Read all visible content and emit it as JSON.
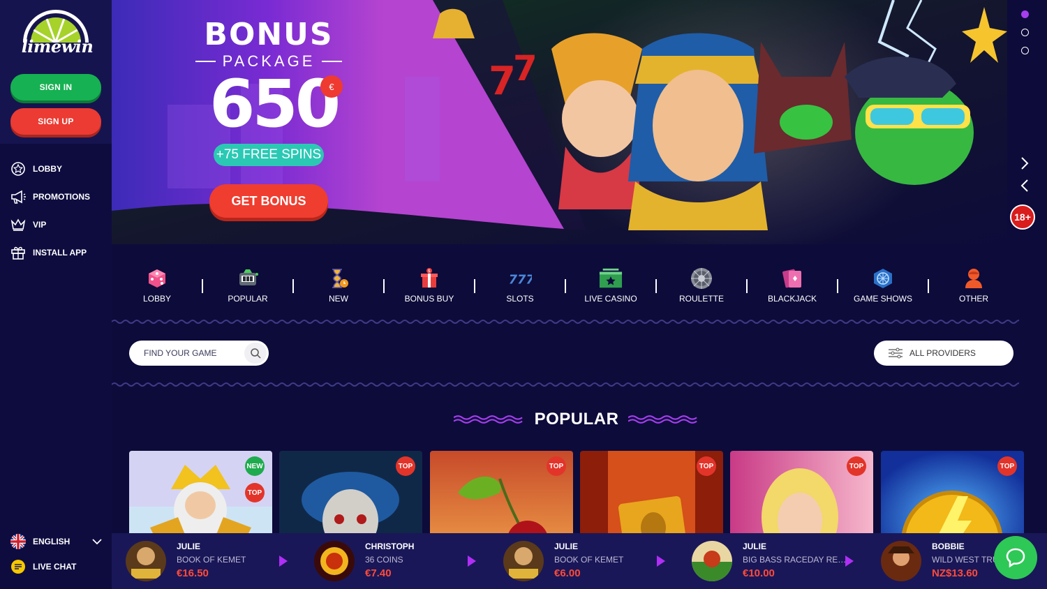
{
  "brand": {
    "logo_text": "limewin"
  },
  "auth": {
    "signin_label": "SIGN IN",
    "signup_label": "SIGN UP"
  },
  "sidebar": {
    "items": [
      {
        "label": "LOBBY",
        "icon": "star-badge-icon"
      },
      {
        "label": "PROMOTIONS",
        "icon": "megaphone-icon"
      },
      {
        "label": "VIP",
        "icon": "crown-icon"
      },
      {
        "label": "INSTALL APP",
        "icon": "gift-box-icon"
      }
    ],
    "language": "ENGLISH",
    "live_chat": "LIVE CHAT"
  },
  "banner": {
    "title": "BONUS",
    "subtitle": "PACKAGE",
    "amount": "650",
    "currency": "€",
    "spins": "+75 FREE SPINS",
    "cta": "GET BONUS",
    "age_badge": "18+",
    "slide_count": 3,
    "active_slide": 1
  },
  "categories": [
    {
      "label": "LOBBY",
      "icon": "dice-icon"
    },
    {
      "label": "POPULAR",
      "icon": "slot-machine-icon"
    },
    {
      "label": "NEW",
      "icon": "hourglass-icon"
    },
    {
      "label": "BONUS BUY",
      "icon": "gift-icon"
    },
    {
      "label": "SLOTS",
      "icon": "777-icon"
    },
    {
      "label": "LIVE CASINO",
      "icon": "live-screen-icon"
    },
    {
      "label": "ROULETTE",
      "icon": "roulette-icon"
    },
    {
      "label": "BLACKJACK",
      "icon": "cards-icon"
    },
    {
      "label": "GAME SHOWS",
      "icon": "game-show-icon"
    },
    {
      "label": "OTHER",
      "icon": "person-icon"
    }
  ],
  "search": {
    "placeholder": "FIND YOUR GAME",
    "providers_label": "ALL PROVIDERS"
  },
  "section": {
    "title": "POPULAR"
  },
  "games": [
    {
      "tags": [
        "NEW",
        "TOP"
      ],
      "colors": [
        "#c6e3f3",
        "#d8c8f0"
      ]
    },
    {
      "tags": [
        "TOP"
      ],
      "colors": [
        "#1d3c66",
        "#0c1a34"
      ]
    },
    {
      "tags": [
        "TOP"
      ],
      "colors": [
        "#d45a2a",
        "#f0a14a"
      ]
    },
    {
      "tags": [
        "TOP"
      ],
      "colors": [
        "#a4250c",
        "#e8641b"
      ]
    },
    {
      "tags": [
        "TOP"
      ],
      "colors": [
        "#d6438e",
        "#f7b2c4"
      ]
    },
    {
      "tags": [
        "TOP"
      ],
      "colors": [
        "#1742b7",
        "#3b8ef0"
      ]
    }
  ],
  "winners": [
    {
      "name": "JULIE",
      "game": "BOOK OF KEMET",
      "amount": "€16.50"
    },
    {
      "name": "CHRISTOPH",
      "game": "36 COINS",
      "amount": "€7.40"
    },
    {
      "name": "JULIE",
      "game": "BOOK OF KEMET",
      "amount": "€6.00"
    },
    {
      "name": "JULIE",
      "game": "BIG BASS RACEDAY REP...",
      "amount": "€10.00"
    },
    {
      "name": "BOBBIE",
      "game": "WILD WEST TRUE",
      "amount": "NZ$13.60"
    }
  ],
  "colors": {
    "accent_purple": "#a63ef0",
    "green": "#16b152",
    "red": "#eb3b33",
    "bg": "#0d0b3a"
  }
}
